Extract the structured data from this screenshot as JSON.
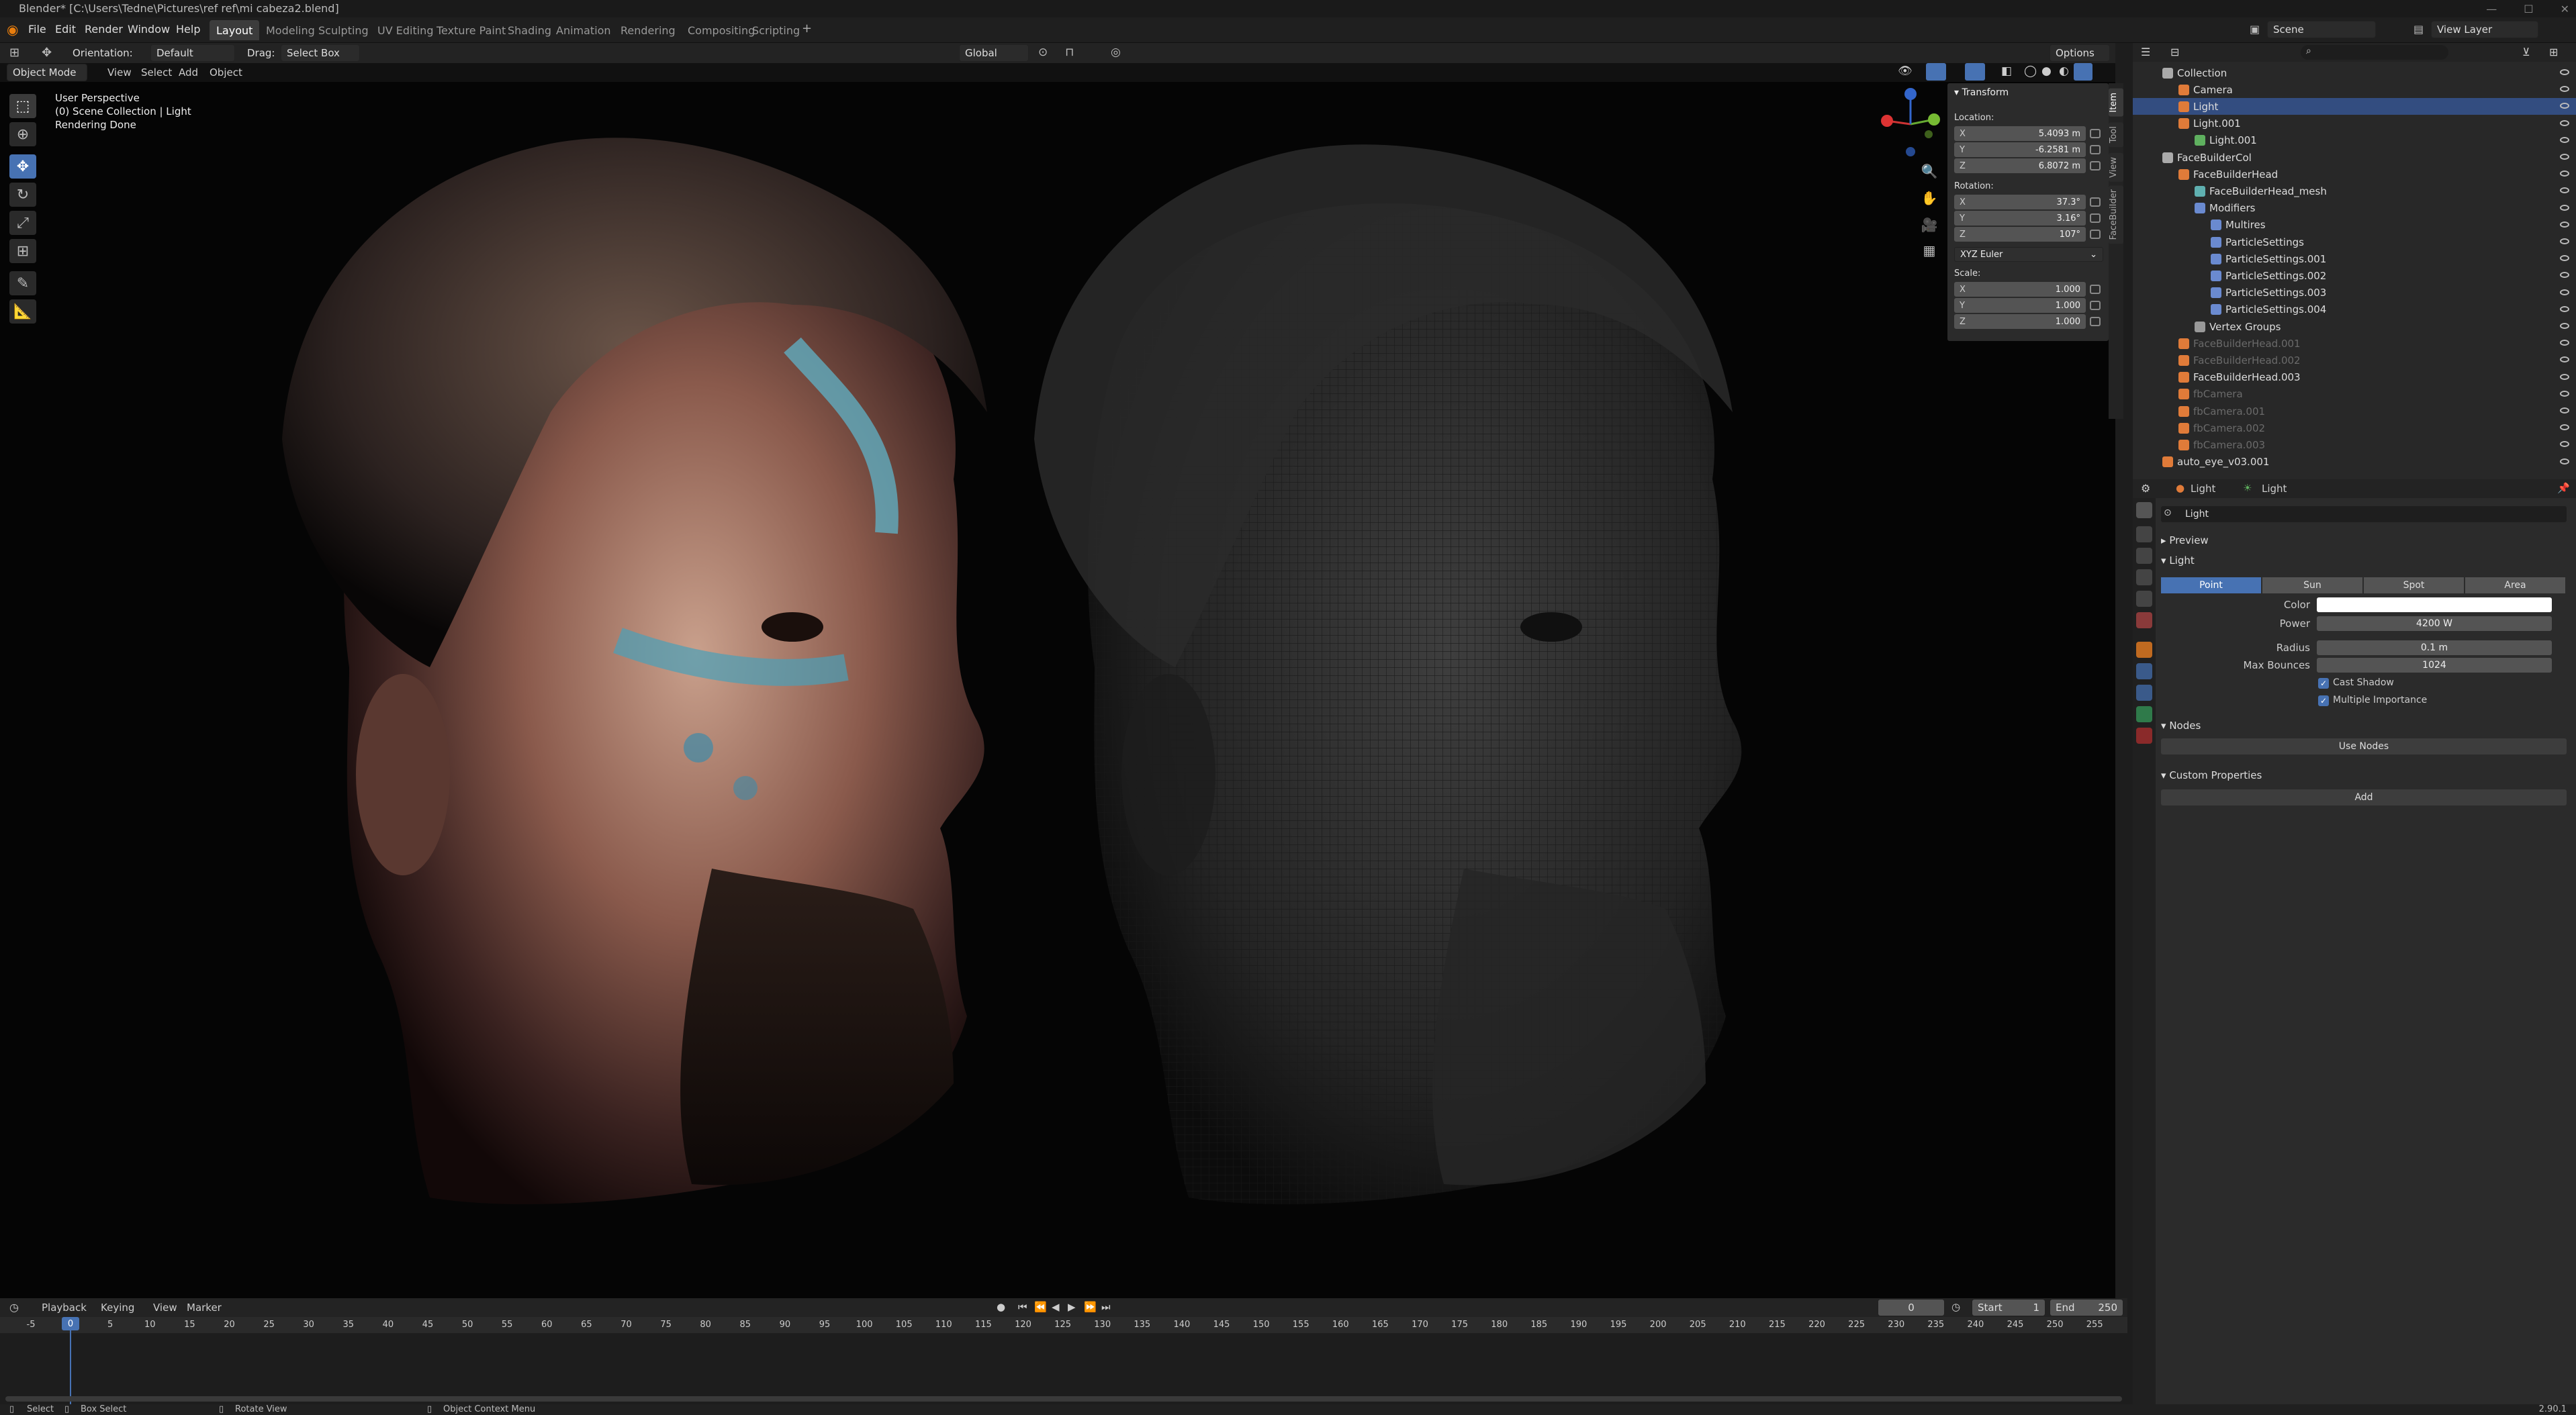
{
  "titlebar": {
    "title": "Blender* [C:\\Users\\Tedne\\Pictures\\ref ref\\mi cabeza2.blend]"
  },
  "menus": [
    "File",
    "Edit",
    "Render",
    "Window",
    "Help"
  ],
  "workspaces": [
    "Layout",
    "Modeling",
    "Sculpting",
    "UV Editing",
    "Texture Paint",
    "Shading",
    "Animation",
    "Rendering",
    "Compositing",
    "Scripting"
  ],
  "active_workspace": "Layout",
  "scene": {
    "label": "Scene",
    "view_layer": "View Layer"
  },
  "toolheader": {
    "orientation_label": "Orientation:",
    "orientation_value": "Default",
    "drag_label": "Drag:",
    "drag_value": "Select Box",
    "transform_orientation": "Global",
    "options": "Options"
  },
  "viewport_header": {
    "mode": "Object Mode",
    "view": "View",
    "select": "Select",
    "add": "Add",
    "object": "Object"
  },
  "viewport_overlay": {
    "line1": "User Perspective",
    "line2": "(0) Scene Collection | Light",
    "line3": "Rendering Done"
  },
  "npanel": {
    "title": "Transform",
    "location_label": "Location:",
    "location": {
      "x": "5.4093 m",
      "y": "-6.2581 m",
      "z": "6.8072 m"
    },
    "rotation_label": "Rotation:",
    "rotation": {
      "x": "37.3°",
      "y": "3.16°",
      "z": "107°"
    },
    "rotation_mode": "XYZ Euler",
    "scale_label": "Scale:",
    "scale": {
      "x": "1.000",
      "y": "1.000",
      "z": "1.000"
    },
    "axis": {
      "x": "X",
      "y": "Y",
      "z": "Z"
    },
    "tabs": [
      "Item",
      "Tool",
      "View",
      "FaceBuilder"
    ]
  },
  "outliner": {
    "rows": [
      {
        "label": "Collection",
        "indent": 1,
        "color": "#aaaaaa",
        "dim": false
      },
      {
        "label": "Camera",
        "indent": 2,
        "color": "#e07b39",
        "dim": false
      },
      {
        "label": "Light",
        "indent": 2,
        "color": "#e07b39",
        "dim": false,
        "selected": true
      },
      {
        "label": "Light.001",
        "indent": 2,
        "color": "#e07b39",
        "dim": false
      },
      {
        "label": "Light.001",
        "indent": 3,
        "color": "#5fb05f",
        "dim": false
      },
      {
        "label": "FaceBuilderCol",
        "indent": 1,
        "color": "#aaaaaa",
        "dim": false
      },
      {
        "label": "FaceBuilderHead",
        "indent": 2,
        "color": "#e07b39",
        "dim": false
      },
      {
        "label": "FaceBuilderHead_mesh",
        "indent": 3,
        "color": "#5fb0b0",
        "dim": false
      },
      {
        "label": "Modifiers",
        "indent": 3,
        "color": "#6a8ad0",
        "dim": false
      },
      {
        "label": "Multires",
        "indent": 4,
        "color": "#6a8ad0",
        "dim": false
      },
      {
        "label": "ParticleSettings",
        "indent": 4,
        "color": "#6a8ad0",
        "dim": false
      },
      {
        "label": "ParticleSettings.001",
        "indent": 4,
        "color": "#6a8ad0",
        "dim": false
      },
      {
        "label": "ParticleSettings.002",
        "indent": 4,
        "color": "#6a8ad0",
        "dim": false
      },
      {
        "label": "ParticleSettings.003",
        "indent": 4,
        "color": "#6a8ad0",
        "dim": false
      },
      {
        "label": "ParticleSettings.004",
        "indent": 4,
        "color": "#6a8ad0",
        "dim": false
      },
      {
        "label": "Vertex Groups",
        "indent": 3,
        "color": "#999999",
        "dim": false
      },
      {
        "label": "FaceBuilderHead.001",
        "indent": 2,
        "color": "#e07b39",
        "dim": true
      },
      {
        "label": "FaceBuilderHead.002",
        "indent": 2,
        "color": "#e07b39",
        "dim": true
      },
      {
        "label": "FaceBuilderHead.003",
        "indent": 2,
        "color": "#e07b39",
        "dim": false
      },
      {
        "label": "fbCamera",
        "indent": 2,
        "color": "#e07b39",
        "dim": true
      },
      {
        "label": "fbCamera.001",
        "indent": 2,
        "color": "#e07b39",
        "dim": true
      },
      {
        "label": "fbCamera.002",
        "indent": 2,
        "color": "#e07b39",
        "dim": true
      },
      {
        "label": "fbCamera.003",
        "indent": 2,
        "color": "#e07b39",
        "dim": true
      },
      {
        "label": "auto_eye_v03.001",
        "indent": 1,
        "color": "#e07b39",
        "dim": false
      }
    ]
  },
  "properties": {
    "breadcrumb_obj": "Light",
    "breadcrumb_data": "Light",
    "datablock": "Light",
    "sections": {
      "preview": "Preview",
      "light": "Light",
      "nodes": "Nodes",
      "custom": "Custom Properties"
    },
    "light_types": [
      "Point",
      "Sun",
      "Spot",
      "Area"
    ],
    "active_type": "Point",
    "color_label": "Color",
    "color_value": "#ffffff",
    "power_label": "Power",
    "power": "4200 W",
    "radius_label": "Radius",
    "radius": "0.1 m",
    "bounces_label": "Max Bounces",
    "bounces": "1024",
    "cast_shadow": "Cast Shadow",
    "multiple_importance": "Multiple Importance",
    "use_nodes": "Use Nodes",
    "add": "Add"
  },
  "timeline": {
    "menus": [
      "Playback",
      "Keying",
      "View",
      "Marker"
    ],
    "current_frame": "0",
    "start_label": "Start",
    "start": "1",
    "end_label": "End",
    "end": "250",
    "ticks": [
      "-5",
      "0",
      "5",
      "10",
      "15",
      "20",
      "25",
      "30",
      "35",
      "40",
      "45",
      "50",
      "55",
      "60",
      "65",
      "70",
      "75",
      "80",
      "85",
      "90",
      "95",
      "100",
      "105",
      "110",
      "115",
      "120",
      "125",
      "130",
      "135",
      "140",
      "145",
      "150",
      "155",
      "160",
      "165",
      "170",
      "175",
      "180",
      "185",
      "190",
      "195",
      "200",
      "205",
      "210",
      "215",
      "220",
      "225",
      "230",
      "235",
      "240",
      "245",
      "250",
      "255"
    ],
    "playhead_label": "0"
  },
  "statusbar": {
    "select": "Select",
    "box_select": "Box Select",
    "rotate_view": "Rotate View",
    "context_menu": "Object Context Menu",
    "version": "2.90.1"
  }
}
